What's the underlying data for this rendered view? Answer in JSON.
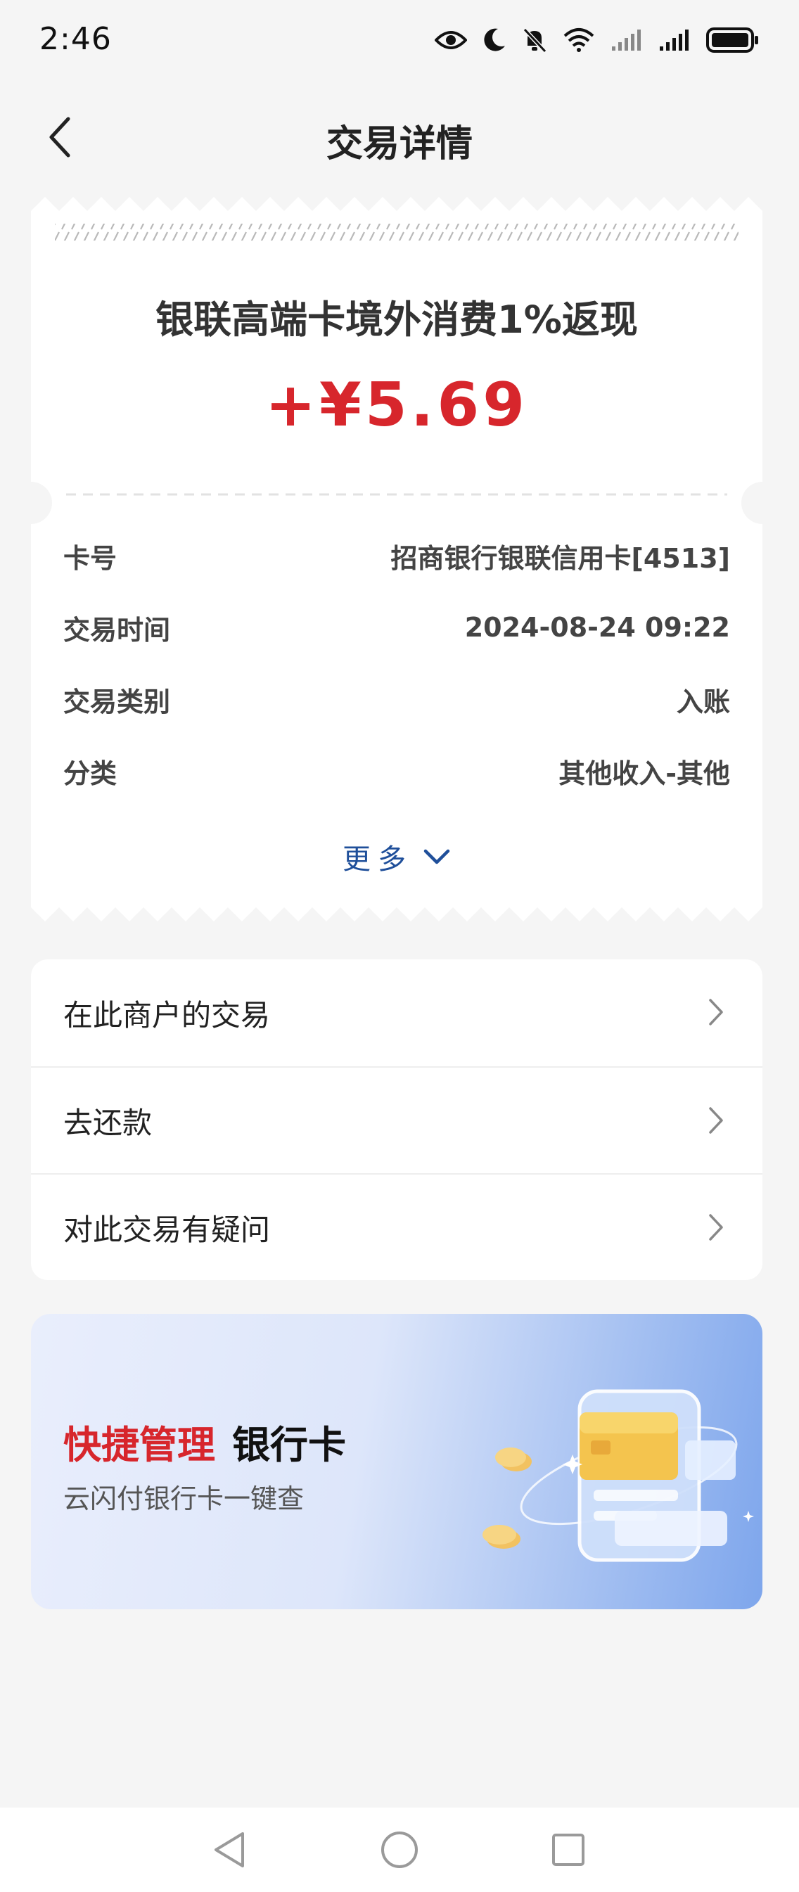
{
  "status_bar": {
    "time": "2:46",
    "icons": [
      "eye-icon",
      "moon-icon",
      "bell-off-icon",
      "wifi-icon",
      "signal-icon",
      "signal-icon",
      "battery-icon"
    ]
  },
  "header": {
    "title": "交易详情",
    "back_icon": "chevron-left-icon"
  },
  "receipt": {
    "title": "银联高端卡境外消费1%返现",
    "amount": "+¥5.69",
    "amount_color": "#d7262c",
    "details": [
      {
        "label": "卡号",
        "value": "招商银行银联信用卡[4513]"
      },
      {
        "label": "交易时间",
        "value": "2024-08-24 09:22"
      },
      {
        "label": "交易类别",
        "value": "入账"
      },
      {
        "label": "分类",
        "value": "其他收入-其他"
      }
    ],
    "more_label": "更多",
    "more_icon": "chevron-down-icon"
  },
  "actions": [
    {
      "label": "在此商户的交易",
      "icon": "chevron-right-icon"
    },
    {
      "label": "去还款",
      "icon": "chevron-right-icon"
    },
    {
      "label": "对此交易有疑问",
      "icon": "chevron-right-icon"
    }
  ],
  "banner": {
    "title_accent": "快捷管理",
    "title_main": "银行卡",
    "subtitle": "云闪付银行卡一键查",
    "accent_color": "#d7262c"
  },
  "system_nav": {
    "back_icon": "triangle-back-icon",
    "home_icon": "circle-home-icon",
    "recents_icon": "square-recents-icon"
  }
}
